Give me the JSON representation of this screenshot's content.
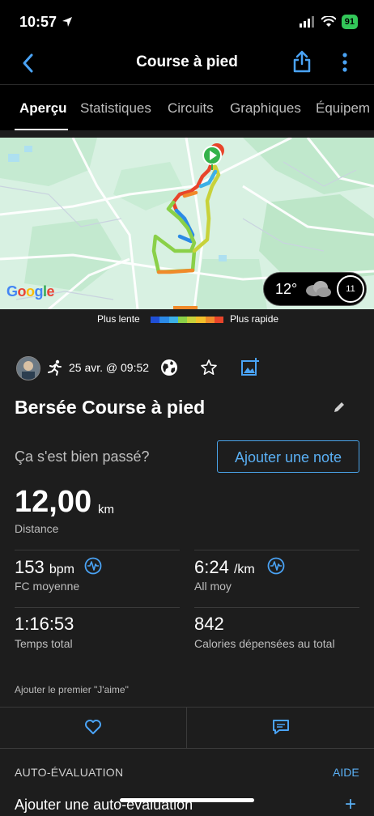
{
  "status": {
    "time": "10:57",
    "battery": "91"
  },
  "nav": {
    "title": "Course à pied"
  },
  "tabs": [
    "Aperçu",
    "Statistiques",
    "Circuits",
    "Graphiques",
    "Équipem"
  ],
  "map": {
    "google_label": "Google",
    "weather": {
      "temp": "12°",
      "wind": "11"
    }
  },
  "legend": {
    "slow": "Plus lente",
    "fast": "Plus rapide",
    "colors": [
      "#1f4fd6",
      "#2b8ae6",
      "#3cb0e6",
      "#8ad048",
      "#c8d23a",
      "#f2c02b",
      "#f08a2a",
      "#e8442a"
    ]
  },
  "activity": {
    "date": "25 avr. @ 09:52",
    "title": "Bersée Course à pied",
    "question": "Ça s'est bien passé?",
    "note_button": "Ajouter une note"
  },
  "distance": {
    "value": "12,00",
    "unit": "km",
    "label": "Distance"
  },
  "stats": {
    "hr": {
      "value": "153",
      "unit": "bpm",
      "label": "FC moyenne"
    },
    "pace": {
      "value": "6:24",
      "unit": "/km",
      "label": "All moy"
    },
    "time": {
      "value": "1:16:53",
      "label": "Temps total"
    },
    "calories": {
      "value": "842",
      "label": "Calories dépensées au total"
    }
  },
  "social": {
    "like_text": "Ajouter le premier \"J'aime\""
  },
  "self_eval": {
    "title": "AUTO-ÉVALUATION",
    "help": "AIDE",
    "add": "Ajouter une auto-évaluation",
    "plus": "+"
  }
}
